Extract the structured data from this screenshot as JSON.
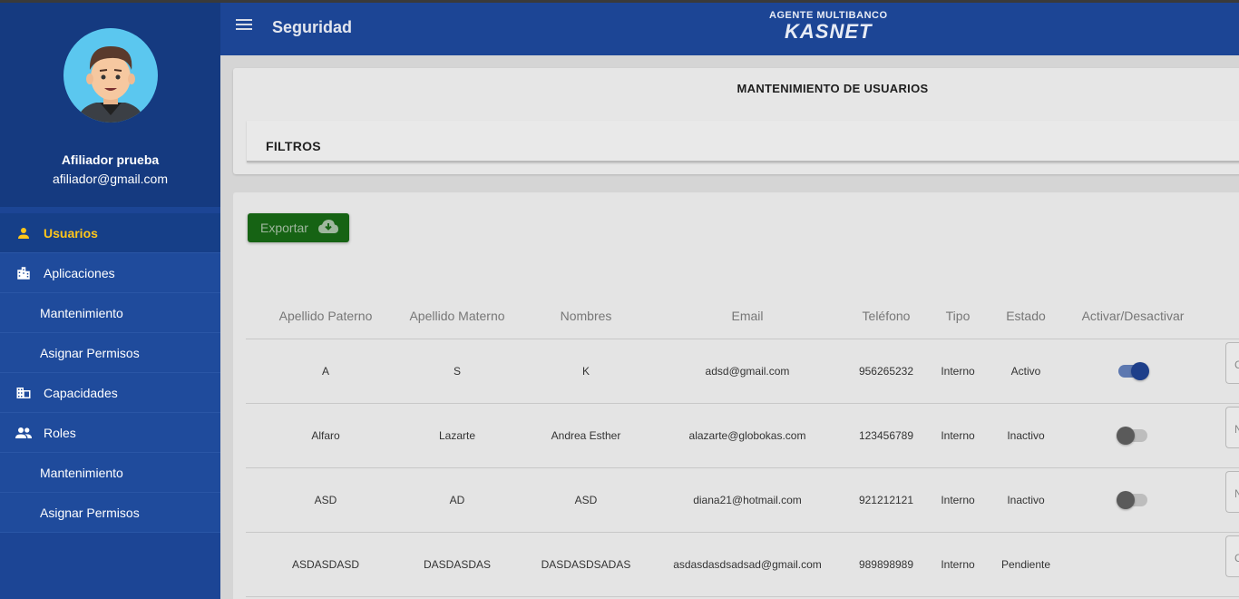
{
  "sidebar": {
    "user_name": "Afiliador prueba",
    "user_email": "afiliador@gmail.com",
    "items": [
      {
        "label": "Usuarios",
        "icon": "person-icon"
      },
      {
        "label": "Aplicaciones",
        "icon": "building-icon"
      },
      {
        "label": "Mantenimiento"
      },
      {
        "label": "Asignar Permisos"
      },
      {
        "label": "Capacidades",
        "icon": "business-icon"
      },
      {
        "label": "Roles",
        "icon": "people-icon"
      },
      {
        "label": "Mantenimiento"
      },
      {
        "label": "Asignar Permisos"
      }
    ]
  },
  "header": {
    "title": "Seguridad",
    "brand_top": "AGENTE MULTIBANCO",
    "brand_logo": "KASNET"
  },
  "main": {
    "title": "MANTENIMIENTO DE USUARIOS",
    "filters_label": "FILTROS",
    "export_label": "Exportar",
    "columns": [
      "Apellido Paterno",
      "Apellido Materno",
      "Nombres",
      "Email",
      "Teléfono",
      "Tipo",
      "Estado",
      "Activar/Desactivar"
    ],
    "rows": [
      {
        "apellido_paterno": "A",
        "apellido_materno": "S",
        "nombres": "K",
        "email": "adsd@gmail.com",
        "telefono": "956265232",
        "tipo": "Interno",
        "estado": "Activo",
        "toggle": "on",
        "action": "C"
      },
      {
        "apellido_paterno": "Alfaro",
        "apellido_materno": "Lazarte",
        "nombres": "Andrea Esther",
        "email": "alazarte@globokas.com",
        "telefono": "123456789",
        "tipo": "Interno",
        "estado": "Inactivo",
        "toggle": "off",
        "action": "N"
      },
      {
        "apellido_paterno": "ASD",
        "apellido_materno": "AD",
        "nombres": "ASD",
        "email": "diana21@hotmail.com",
        "telefono": "921212121",
        "tipo": "Interno",
        "estado": "Inactivo",
        "toggle": "off",
        "action": "N"
      },
      {
        "apellido_paterno": "ASDASDASD",
        "apellido_materno": "DASDASDAS",
        "nombres": "DASDASDSADAS",
        "email": "asdasdasdsadsad@gmail.com",
        "telefono": "989898989",
        "tipo": "Interno",
        "estado": "Pendiente",
        "toggle": "none",
        "action": "C"
      }
    ]
  },
  "colors": {
    "sidebar": "#1c4595",
    "active_text": "#ffc61a",
    "export_button": "#166314",
    "toggle_on": "#1e3f8a"
  }
}
